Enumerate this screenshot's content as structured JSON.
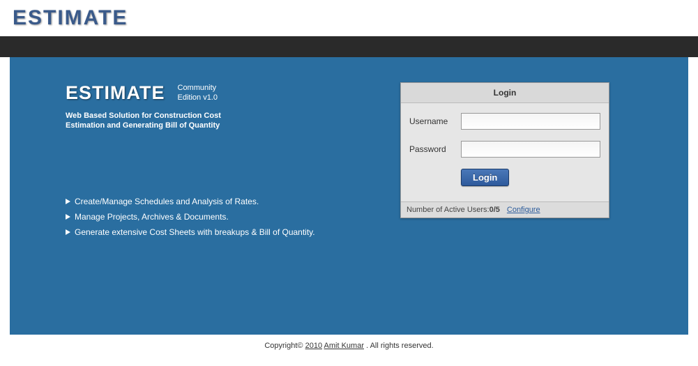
{
  "brand": {
    "logo_text": "ESTIMATE"
  },
  "hero": {
    "title": "ESTIMATE",
    "edition_line1": "Community",
    "edition_line2": "Edition v1.0",
    "tagline_line1": "Web Based Solution for Construction Cost",
    "tagline_line2": "Estimation and Generating Bill of Quantity"
  },
  "features": [
    "Create/Manage Schedules and Analysis of Rates.",
    "Manage Projects, Archives & Documents.",
    "Generate extensive Cost Sheets with breakups & Bill of Quantity."
  ],
  "login": {
    "heading": "Login",
    "username_label": "Username",
    "password_label": "Password",
    "username_value": "",
    "password_value": "",
    "button_label": "Login",
    "active_users_label": "Number of Active Users: ",
    "active_users_value": "0/5",
    "configure_label": "Configure"
  },
  "footer": {
    "copyright_prefix": "Copyright© ",
    "year": "2010",
    "author": "Amit Kumar",
    "suffix": ". All rights reserved."
  }
}
